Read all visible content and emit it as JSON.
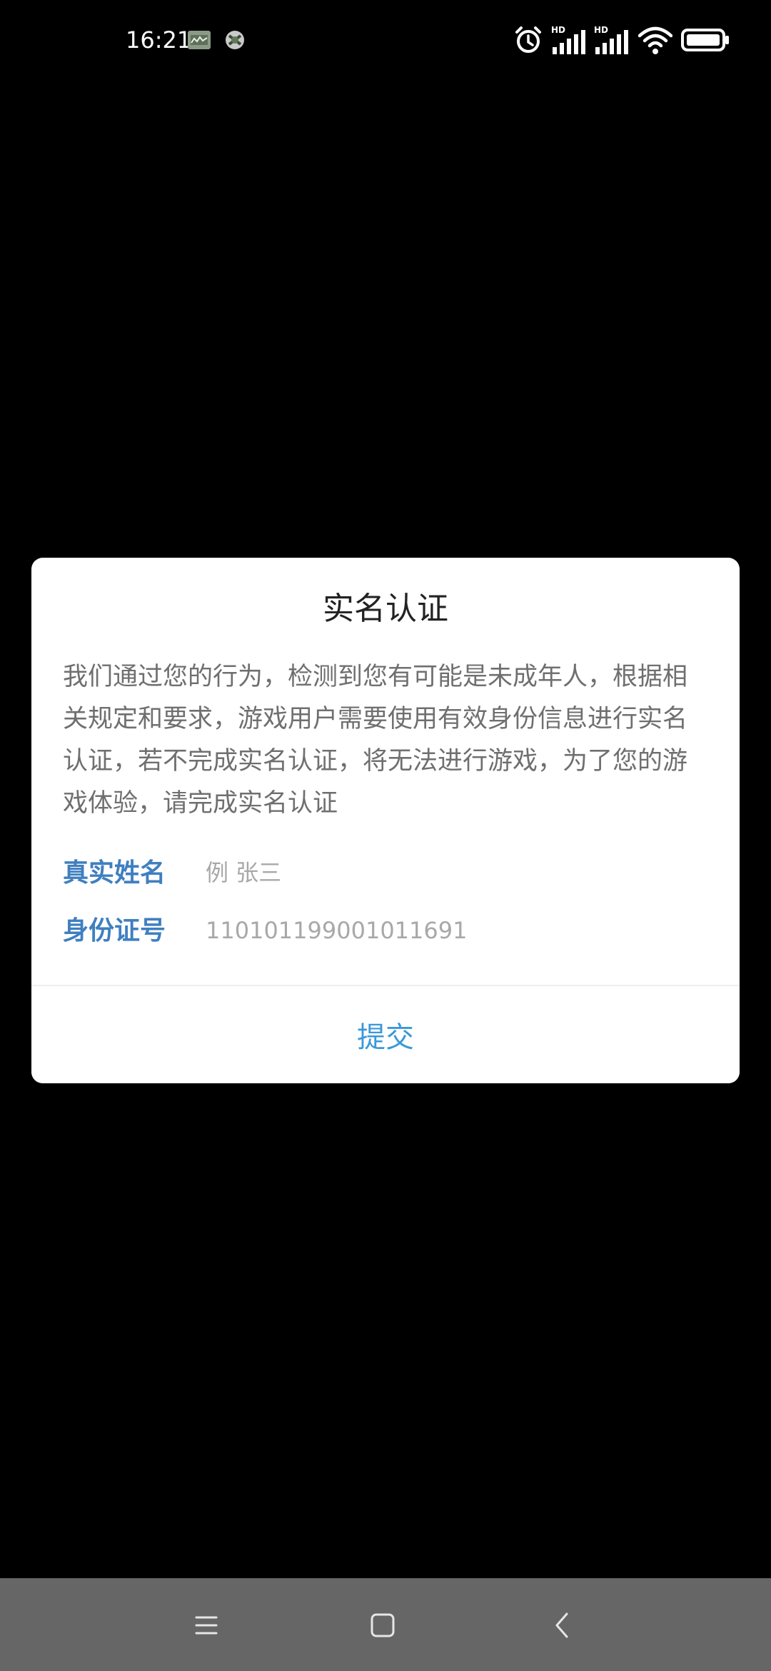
{
  "status_bar": {
    "time": "16:21",
    "network_badge": "HD"
  },
  "dialog": {
    "title": "实名认证",
    "message": "我们通过您的行为，检测到您有可能是未成年人，根据相关规定和要求，游戏用户需要使用有效身份信息进行实名认证，若不完成实名认证，将无法进行游戏，为了您的游戏体验，请完成实名认证",
    "fields": {
      "name": {
        "label": "真实姓名",
        "placeholder": "例 张三",
        "value": ""
      },
      "id_number": {
        "label": "身份证号",
        "placeholder": "110101199001011691",
        "value": ""
      }
    },
    "submit_label": "提交"
  },
  "nav_bar": {
    "icons": [
      "menu-icon",
      "home-icon",
      "back-icon"
    ]
  },
  "colors": {
    "background": "#000000",
    "dialog_bg": "#ffffff",
    "label_blue": "#3f7fc0",
    "submit_blue": "#3a98d8",
    "message_gray": "#6f6f6f",
    "nav_bar_bg": "#666666"
  }
}
